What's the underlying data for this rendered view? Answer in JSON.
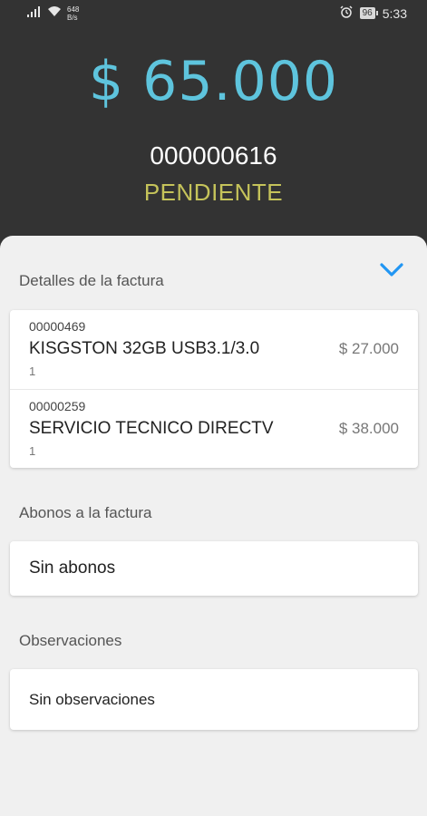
{
  "status_bar": {
    "net_speed_value": "648",
    "net_speed_unit": "B/s",
    "battery": "96",
    "time": "5:33",
    "icons": [
      "signal-icon",
      "wifi-icon",
      "alarm-icon",
      "battery-icon"
    ]
  },
  "header": {
    "amount": "$ 65.000",
    "invoice_number": "000000616",
    "status": "PENDIENTE"
  },
  "details": {
    "title": "Detalles de la factura",
    "items": [
      {
        "code": "00000469",
        "name": "KISGSTON 32GB USB3.1/3.0",
        "qty": "1",
        "price": "$ 27.000"
      },
      {
        "code": "00000259",
        "name": "SERVICIO TECNICO DIRECTV",
        "qty": "1",
        "price": "$ 38.000"
      }
    ]
  },
  "payments": {
    "title": "Abonos a la factura",
    "empty_text": "Sin abonos"
  },
  "observations": {
    "title": "Observaciones",
    "empty_text": "Sin observaciones"
  },
  "colors": {
    "header_bg": "#333333",
    "amount": "#5ec4dd",
    "status": "#c5c35a",
    "accent": "#2196f3",
    "sheet_bg": "#f0f0f0"
  }
}
